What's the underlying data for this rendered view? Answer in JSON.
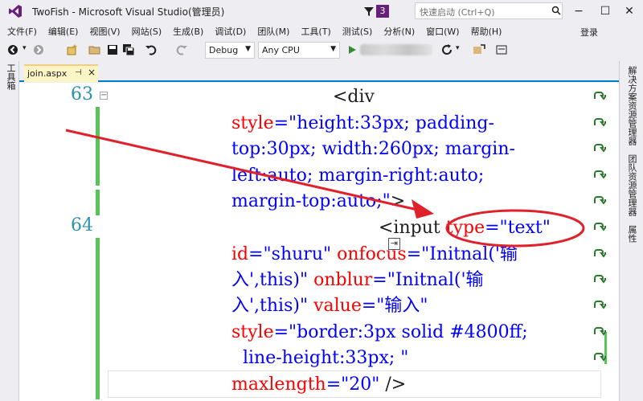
{
  "window": {
    "title": "TwoFish - Microsoft Visual Studio(管理员)",
    "notification_count": "3",
    "quick_launch_placeholder": "快速启动 (Ctrl+Q)",
    "minimize": "−",
    "maximize": "☐",
    "close": "✕"
  },
  "menu": {
    "items": [
      "文件(F)",
      "编辑(E)",
      "视图(V)",
      "网站(S)",
      "生成(B)",
      "调试(D)",
      "团队(M)",
      "工具(T)",
      "测试(S)",
      "分析(N)",
      "窗口(W)",
      "帮助(H)"
    ],
    "login": "登录"
  },
  "toolbar": {
    "config": "Debug",
    "platform": "Any CPU"
  },
  "left_strip": {
    "toolbox": "工具箱"
  },
  "right_strip": {
    "tabs": [
      "解决方案资源管理器",
      "团队资源管理器",
      "属性"
    ]
  },
  "document": {
    "tab_name": "join.aspx",
    "pin": "⊣",
    "close": "×"
  },
  "editor": {
    "lines": [
      {
        "no": "63",
        "segments": [
          {
            "t": "<div",
            "c": "tag"
          }
        ]
      },
      {
        "no": "",
        "segments": [
          {
            "t": "style",
            "c": "attr"
          },
          {
            "t": "=\"height:33px; padding-",
            "c": "val"
          }
        ]
      },
      {
        "no": "",
        "segments": [
          {
            "t": "top:30px; width:260px; margin-",
            "c": "val"
          }
        ]
      },
      {
        "no": "",
        "segments": [
          {
            "t": "left:auto; margin-right:auto;",
            "c": "val"
          }
        ]
      },
      {
        "no": "",
        "segments": [
          {
            "t": "margin-top:auto;\"",
            "c": "val"
          },
          {
            "t": ">",
            "c": "tag"
          }
        ]
      },
      {
        "no": "64",
        "segments": [
          {
            "t": "<input ",
            "c": "tag"
          },
          {
            "t": "type",
            "c": "attr"
          },
          {
            "t": "=\"text\"",
            "c": "val"
          }
        ]
      },
      {
        "no": "",
        "segments": [
          {
            "t": "id",
            "c": "attr"
          },
          {
            "t": "=\"shuru\" ",
            "c": "val"
          },
          {
            "t": "onfocus",
            "c": "attr"
          },
          {
            "t": "=\"Initnal('输",
            "c": "val"
          }
        ]
      },
      {
        "no": "",
        "segments": [
          {
            "t": "入',this)\" ",
            "c": "val"
          },
          {
            "t": "onblur",
            "c": "attr"
          },
          {
            "t": "=\"Initnal('输",
            "c": "val"
          }
        ]
      },
      {
        "no": "",
        "segments": [
          {
            "t": "入',this)\" ",
            "c": "val"
          },
          {
            "t": "value",
            "c": "attr"
          },
          {
            "t": "=\"输入\"",
            "c": "val"
          }
        ]
      },
      {
        "no": "",
        "segments": [
          {
            "t": "style",
            "c": "attr"
          },
          {
            "t": "=\"border:3px solid #4800ff;",
            "c": "val"
          }
        ]
      },
      {
        "no": "",
        "segments": [
          {
            "t": "  line-height:33px; \"",
            "c": "val"
          }
        ]
      },
      {
        "no": "",
        "segments": [
          {
            "t": "maxlength",
            "c": "attr"
          },
          {
            "t": "=\"20\" ",
            "c": "val"
          },
          {
            "t": "/>",
            "c": "tag"
          }
        ]
      }
    ],
    "inline_box_glyph": "⇥"
  },
  "colors": {
    "accent": "#007acc",
    "attr": "#ff0000",
    "value": "#0000ff",
    "line_number": "#2b91af",
    "change_bar": "#57c457",
    "annotation": "#e0212b"
  }
}
